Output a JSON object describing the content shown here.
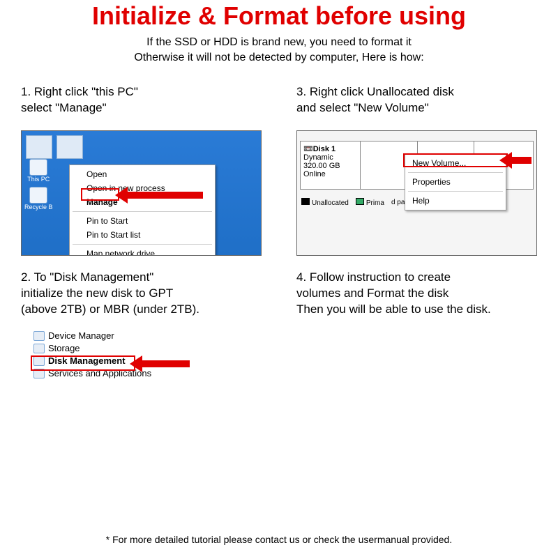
{
  "title": "Initialize & Format before using",
  "subtitle_line1": "If the SSD or HDD is brand new, you need to format it",
  "subtitle_line2": "Otherwise it will not be detected by computer, Here is how:",
  "steps": {
    "s1": {
      "text1": "1. Right click \"this PC\"",
      "text2": "select \"Manage\""
    },
    "s2": {
      "text1": "2. To \"Disk Management\"",
      "text2": "initialize the new disk to GPT",
      "text3": "(above 2TB) or MBR (under 2TB)."
    },
    "s3": {
      "text1": "3. Right click Unallocated disk",
      "text2": "and select \"New Volume\""
    },
    "s4": {
      "text1": "4. Follow instruction to create",
      "text2": "volumes and Format the disk",
      "text3": "Then you will be able to use the disk."
    }
  },
  "ctx1": {
    "open": "Open",
    "open_new": "Open in new process",
    "manage": "Manage",
    "pin_start": "Pin to Start",
    "pin_start_list": "Pin to Start list",
    "map_drive": "Map network drive..."
  },
  "desktop": {
    "this_pc": "This PC",
    "recycle": "Recycle B"
  },
  "disk": {
    "label": "Disk 1",
    "type": "Dynamic",
    "size": "320.00 GB",
    "status": "Online",
    "legend_unalloc": "Unallocated",
    "legend_primary": "Prima",
    "legend_tail": "d pa"
  },
  "ctx3": {
    "new_volume": "New Volume...",
    "properties": "Properties",
    "help": "Help"
  },
  "tree": {
    "device_manager": "Device Manager",
    "storage": "Storage",
    "disk_management": "Disk Management",
    "services": "Services and Applications"
  },
  "footer": "* For more detailed tutorial please contact us or check the usermanual provided."
}
